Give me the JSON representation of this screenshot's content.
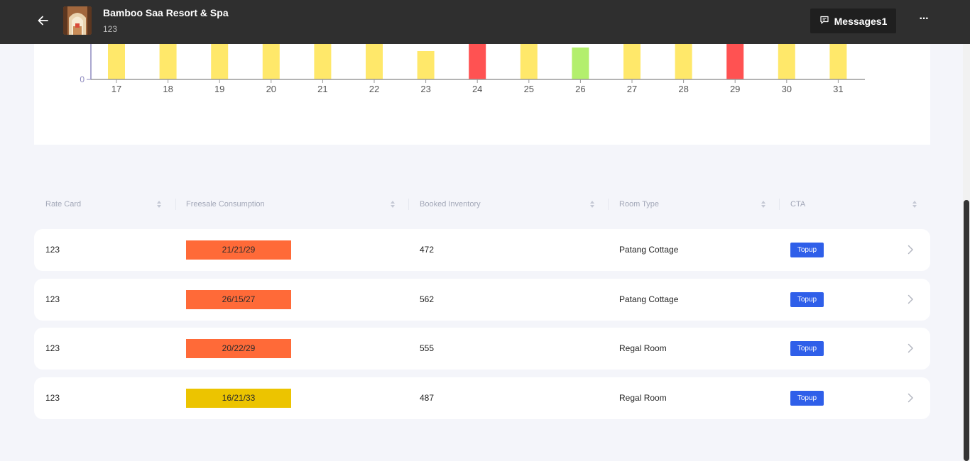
{
  "header": {
    "title": "Bamboo Saa Resort & Spa",
    "subtitle": "123",
    "messages_label": "Messages1",
    "more_label": "···"
  },
  "chart_data": {
    "type": "bar",
    "categories": [
      "17",
      "18",
      "19",
      "20",
      "21",
      "22",
      "23",
      "24",
      "25",
      "26",
      "27",
      "28",
      "29",
      "30",
      "31"
    ],
    "values": [
      null,
      null,
      null,
      null,
      null,
      null,
      40,
      null,
      null,
      45,
      null,
      null,
      null,
      null,
      null
    ],
    "bar_colors": [
      "#ffe86a",
      "#ffe86a",
      "#ffe86a",
      "#ffe86a",
      "#ffe86a",
      "#ffe86a",
      "#ffe86a",
      "#ff5252",
      "#ffe86a",
      "#b3ef6d",
      "#ffe86a",
      "#ffe86a",
      "#ff5252",
      "#ffe86a",
      "#ffe86a"
    ],
    "y_tick_labels": [
      "0"
    ],
    "axis_color": "#8e8abf",
    "note": "bars for most dates extend above the visible area (cropped)"
  },
  "table": {
    "headers": [
      "Rate Card",
      "Freesale Consumption",
      "Booked Inventory",
      "Room Type",
      "CTA"
    ],
    "rows": [
      {
        "rate_card": "123",
        "freesale": "21/21/29",
        "freesale_color": "#ff6a38",
        "booked": "472",
        "room_type": "Patang Cottage",
        "cta": "Topup"
      },
      {
        "rate_card": "123",
        "freesale": "26/15/27",
        "freesale_color": "#ff6a38",
        "booked": "562",
        "room_type": "Patang Cottage",
        "cta": "Topup"
      },
      {
        "rate_card": "123",
        "freesale": "20/22/29",
        "freesale_color": "#ff6a38",
        "booked": "555",
        "room_type": "Regal Room",
        "cta": "Topup"
      },
      {
        "rate_card": "123",
        "freesale": "16/21/33",
        "freesale_color": "#ecc400",
        "booked": "487",
        "room_type": "Regal Room",
        "cta": "Topup"
      }
    ]
  }
}
